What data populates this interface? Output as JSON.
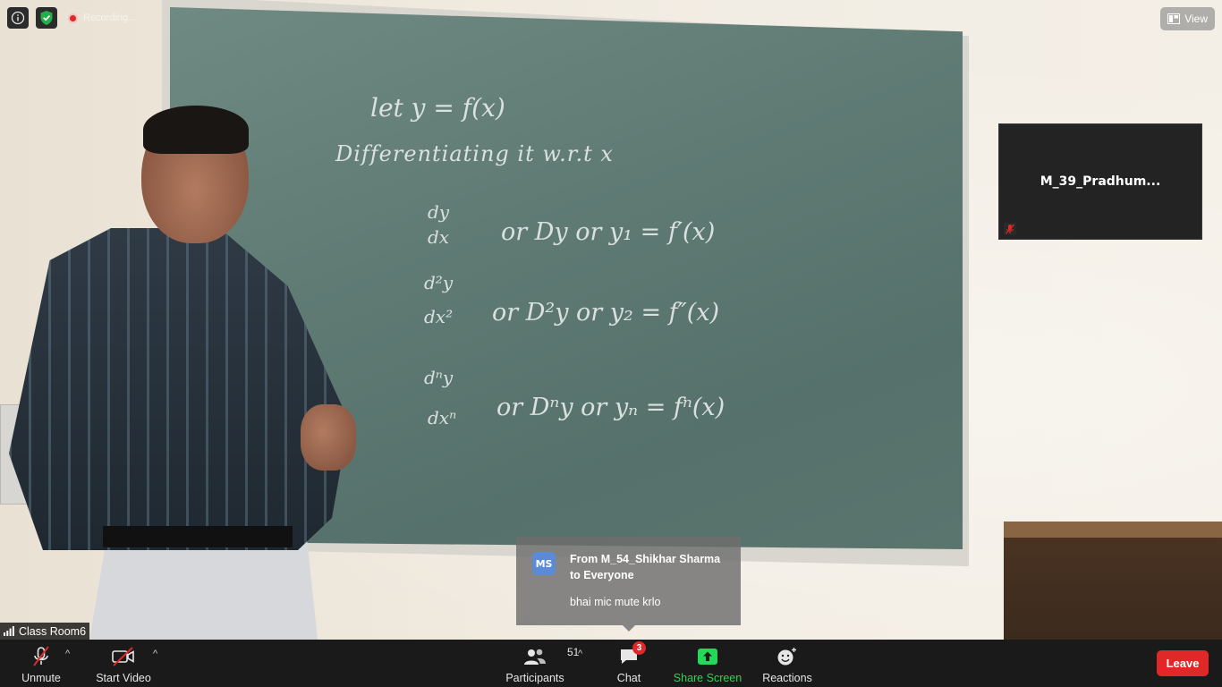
{
  "top_bar": {
    "info_icon": "info-icon",
    "security_icon": "shield-check-icon",
    "recording_label": "Recording...",
    "view_label": "View"
  },
  "video": {
    "speaker_name": "Class Room6"
  },
  "board_text": {
    "line1": "let   y = f(x)",
    "line2": "Differentiating it w.r.t x",
    "line3a": "dy",
    "line3b": "dx",
    "line3c": "or   Dy   or   y₁  =  f′(x)",
    "line4a": "d²y",
    "line4b": "dx²",
    "line4c": "or   D²y   or   y₂  =  f″(x)",
    "line5a": "dⁿy",
    "line5b": "dxⁿ",
    "line5c": "or   Dⁿy   or   yₙ  =  fⁿ(x)"
  },
  "participant_tile": {
    "name": "M_39_Pradhum..."
  },
  "chat_popup": {
    "avatar_initials": "MS",
    "from_line": "From M_54_Shikhar Sharma",
    "to_line": "to Everyone",
    "message": "bhai mic mute krlo"
  },
  "toolbar": {
    "unmute_label": "Unmute",
    "start_video_label": "Start Video",
    "participants_label": "Participants",
    "participants_count": "51",
    "chat_label": "Chat",
    "chat_badge": "3",
    "share_screen_label": "Share Screen",
    "reactions_label": "Reactions",
    "leave_label": "Leave"
  },
  "colors": {
    "toolbar_bg": "#1a1a1a",
    "share_green": "#23d959",
    "leave_red": "#e02828",
    "security_green": "#23b04a"
  }
}
